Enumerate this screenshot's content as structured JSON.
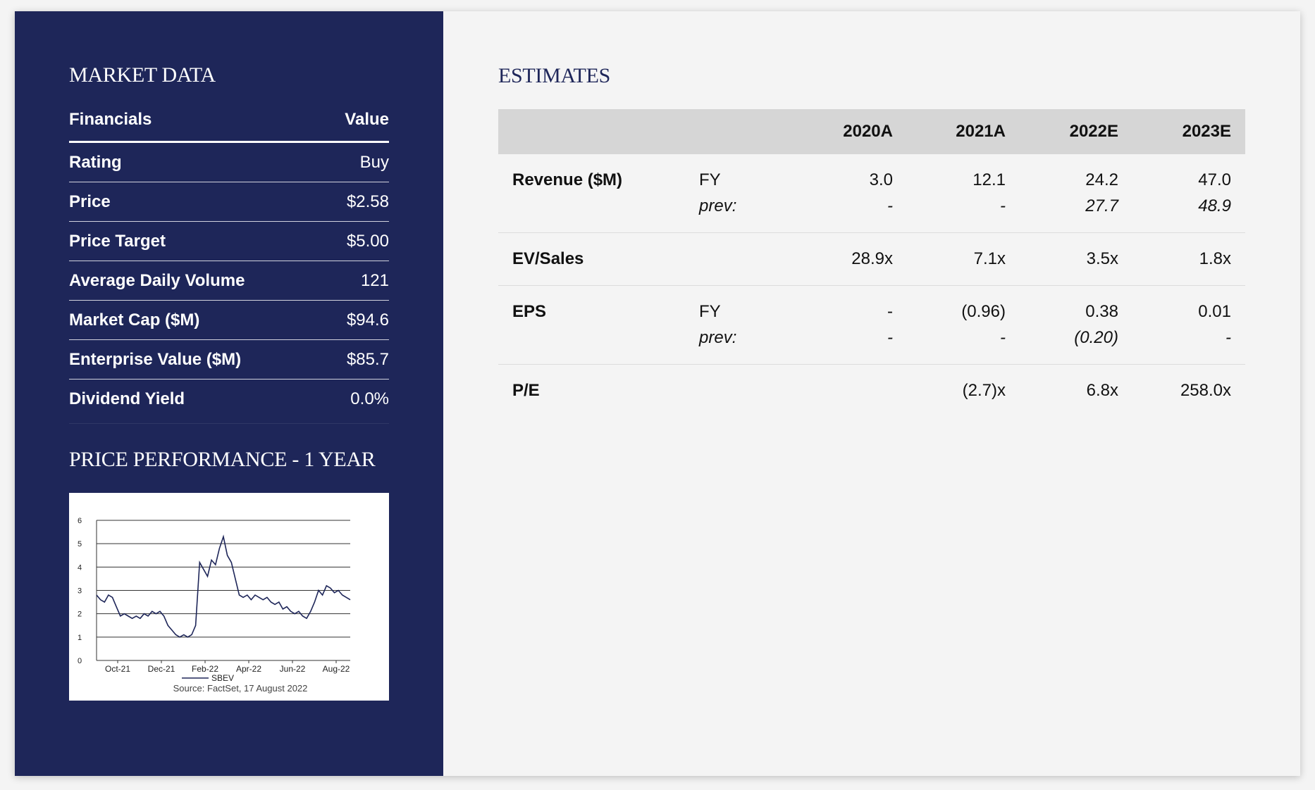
{
  "market_data": {
    "title": "MARKET DATA",
    "header": {
      "label": "Financials",
      "value": "Value"
    },
    "rows": [
      {
        "label": "Rating",
        "value": "Buy"
      },
      {
        "label": "Price",
        "value": "$2.58"
      },
      {
        "label": "Price Target",
        "value": "$5.00"
      },
      {
        "label": "Average Daily Volume",
        "value": "121"
      },
      {
        "label": "Market Cap ($M)",
        "value": "$94.6"
      },
      {
        "label": "Enterprise Value ($M)",
        "value": "$85.7"
      },
      {
        "label": "Dividend Yield",
        "value": "0.0%"
      }
    ]
  },
  "price_performance": {
    "title": "PRICE PERFORMANCE - 1 YEAR",
    "source": "Source: FactSet, 17 August 2022"
  },
  "chart_data": {
    "type": "line",
    "ylim": [
      0,
      6
    ],
    "yticks": [
      "0",
      "1",
      "2",
      "3",
      "4",
      "5",
      "6"
    ],
    "xticks": [
      "Oct-21",
      "Dec-21",
      "Feb-22",
      "Apr-22",
      "Jun-22",
      "Aug-22"
    ],
    "series": [
      {
        "name": "SBEV",
        "color": "#1e2659",
        "values": [
          2.8,
          2.6,
          2.5,
          2.8,
          2.7,
          2.3,
          1.9,
          2.0,
          1.9,
          1.8,
          1.9,
          1.8,
          2.0,
          1.9,
          2.1,
          2.0,
          2.1,
          1.9,
          1.5,
          1.3,
          1.1,
          1.0,
          1.1,
          1.0,
          1.1,
          1.5,
          4.2,
          3.9,
          3.6,
          4.3,
          4.1,
          4.8,
          5.3,
          4.5,
          4.2,
          3.5,
          2.8,
          2.7,
          2.8,
          2.6,
          2.8,
          2.7,
          2.6,
          2.7,
          2.5,
          2.4,
          2.5,
          2.2,
          2.3,
          2.1,
          2.0,
          2.1,
          1.9,
          1.8,
          2.1,
          2.5,
          3.0,
          2.8,
          3.2,
          3.1,
          2.9,
          3.0,
          2.8,
          2.7,
          2.6
        ]
      }
    ],
    "grid": true
  },
  "estimates": {
    "title": "ESTIMATES",
    "years": [
      "2020A",
      "2021A",
      "2022E",
      "2023E"
    ],
    "rows": [
      {
        "label": "Revenue ($M)",
        "lines": [
          {
            "sub": "FY",
            "italic": false,
            "values": [
              "3.0",
              "12.1",
              "24.2",
              "47.0"
            ]
          },
          {
            "sub": "prev:",
            "italic": true,
            "values": [
              "-",
              "-",
              "27.7",
              "48.9"
            ]
          }
        ]
      },
      {
        "label": "EV/Sales",
        "lines": [
          {
            "sub": "",
            "italic": false,
            "values": [
              "28.9x",
              "7.1x",
              "3.5x",
              "1.8x"
            ]
          }
        ]
      },
      {
        "label": "EPS",
        "lines": [
          {
            "sub": "FY",
            "italic": false,
            "values": [
              "-",
              "(0.96)",
              "0.38",
              "0.01"
            ]
          },
          {
            "sub": "prev:",
            "italic": true,
            "values": [
              "-",
              "-",
              "(0.20)",
              "-"
            ]
          }
        ]
      },
      {
        "label": "P/E",
        "lines": [
          {
            "sub": "",
            "italic": false,
            "values": [
              "",
              "(2.7)x",
              "6.8x",
              "258.0x"
            ]
          }
        ]
      }
    ]
  }
}
